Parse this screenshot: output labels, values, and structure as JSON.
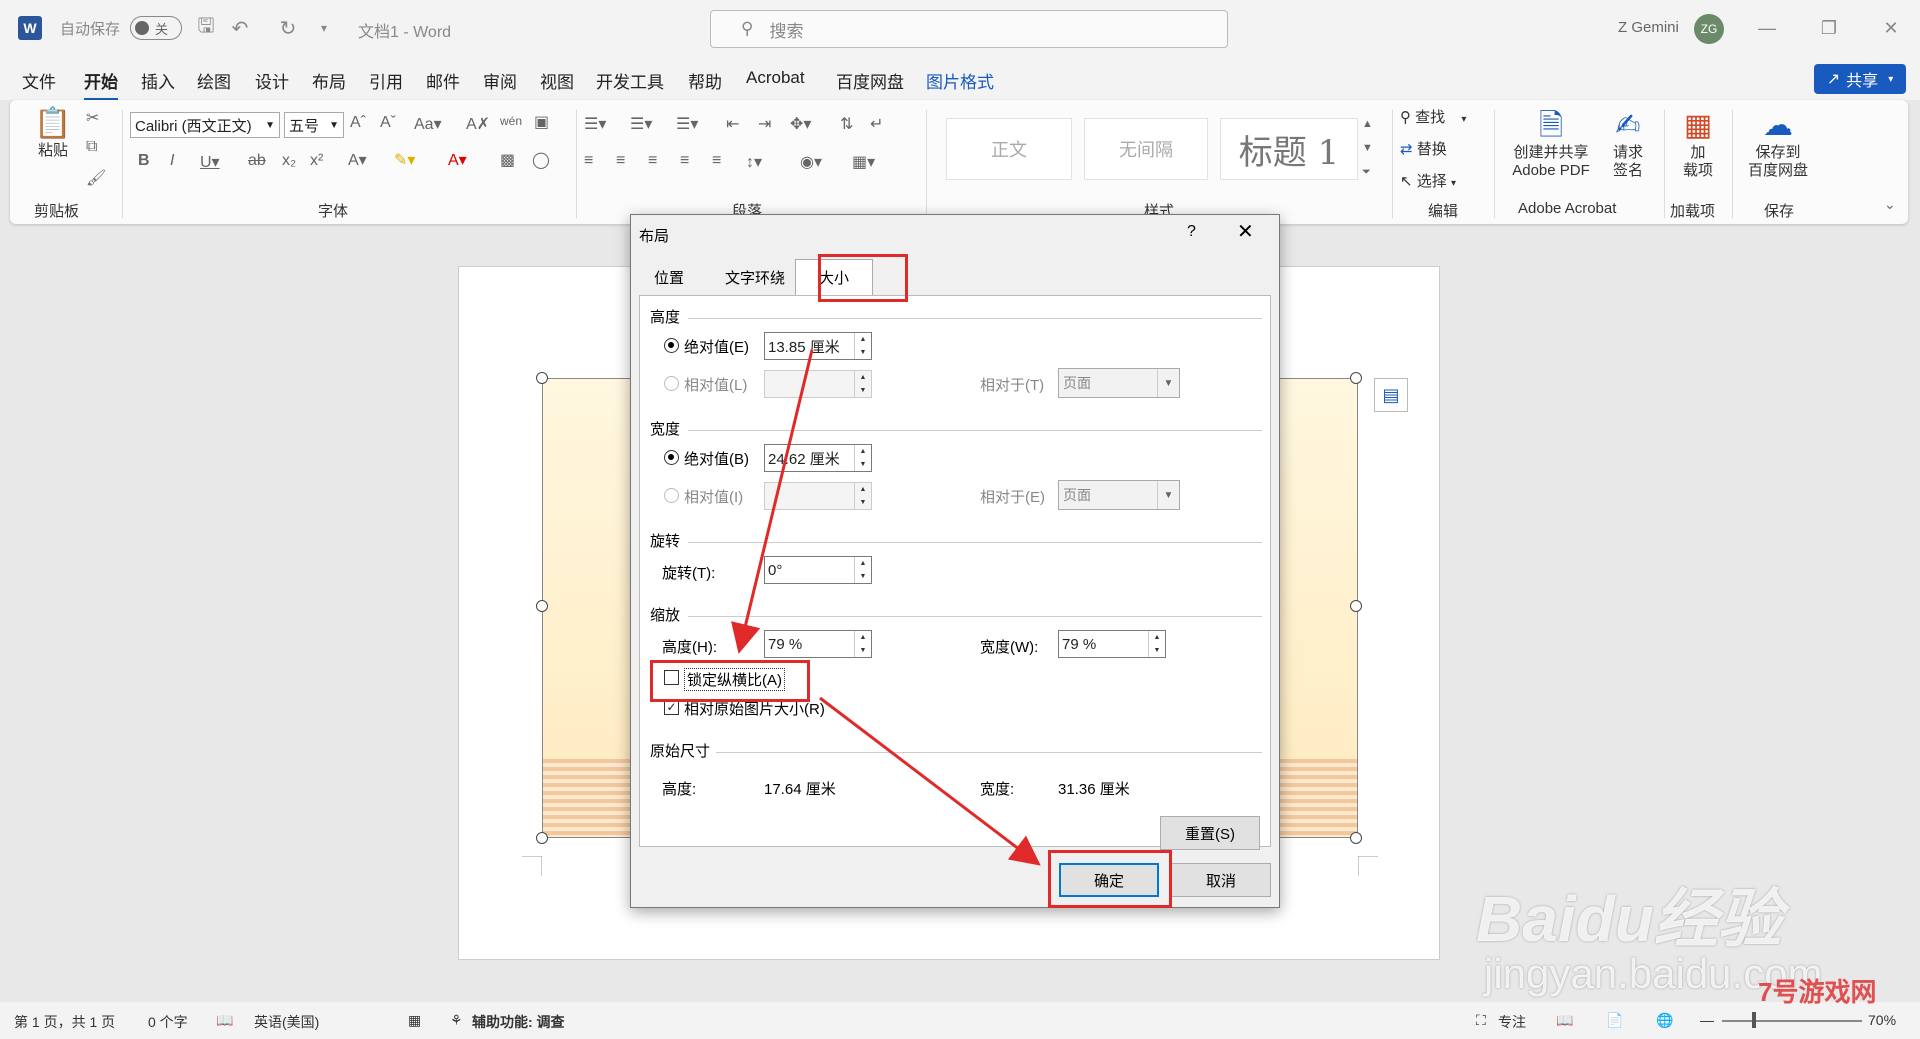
{
  "titlebar": {
    "autosave_label": "自动保存",
    "autosave_state": "关",
    "doc_title": "文档1 - Word",
    "search_placeholder": "搜索",
    "user_name": "Z Gemini",
    "avatar_initials": "ZG"
  },
  "menu": {
    "items": [
      "文件",
      "开始",
      "插入",
      "绘图",
      "设计",
      "布局",
      "引用",
      "邮件",
      "审阅",
      "视图",
      "开发工具",
      "帮助",
      "Acrobat",
      "百度网盘",
      "图片格式"
    ],
    "active": "开始",
    "share_label": "共享"
  },
  "ribbon": {
    "clipboard": {
      "paste": "粘贴",
      "group": "剪贴板"
    },
    "font": {
      "name": "Calibri (西文正文)",
      "size": "五号",
      "group": "字体"
    },
    "paragraph": {
      "group": "段落"
    },
    "styles": {
      "items": [
        "正文",
        "无间隔",
        "标题 1"
      ],
      "group": "样式"
    },
    "editing": {
      "find": "查找",
      "replace": "替换",
      "select": "选择",
      "group": "编辑"
    },
    "acrobat": {
      "create_share": "创建并共享\nAdobe PDF",
      "create_share_line1": "创建并共享",
      "create_share_line2": "Adobe PDF",
      "request_sign_line1": "请求",
      "request_sign_line2": "签名",
      "group": "Adobe Acrobat"
    },
    "addins": {
      "label_line1": "加",
      "label_line2": "载项",
      "group": "加载项"
    },
    "save": {
      "label_line1": "保存到",
      "label_line2": "百度网盘",
      "group": "保存"
    }
  },
  "dialog": {
    "title": "布局",
    "help": "?",
    "tabs": [
      "位置",
      "文字环绕",
      "大小"
    ],
    "active_tab": "大小",
    "height": {
      "section": "高度",
      "absolute_label": "绝对值(E)",
      "absolute_value": "13.85 厘米",
      "relative_label": "相对值(L)",
      "relative_to_label": "相对于(T)",
      "relative_to_value": "页面"
    },
    "width": {
      "section": "宽度",
      "absolute_label": "绝对值(B)",
      "absolute_value": "24.62 厘米",
      "relative_label": "相对值(I)",
      "relative_to_label": "相对于(E)",
      "relative_to_value": "页面"
    },
    "rotation": {
      "section": "旋转",
      "label": "旋转(T):",
      "value": "0°"
    },
    "scale": {
      "section": "缩放",
      "height_label": "高度(H):",
      "height_value": "79 %",
      "width_label": "宽度(W):",
      "width_value": "79 %",
      "lock_aspect_label": "锁定纵横比(A)",
      "lock_aspect_checked": false,
      "relative_original_label": "相对原始图片大小(R)",
      "relative_original_checked": true
    },
    "original": {
      "section": "原始尺寸",
      "height_label": "高度:",
      "height_value": "17.64 厘米",
      "width_label": "宽度:",
      "width_value": "31.36 厘米"
    },
    "reset_label": "重置(S)",
    "ok_label": "确定",
    "cancel_label": "取消"
  },
  "statusbar": {
    "page": "第 1 页，共 1 页",
    "words": "0 个字",
    "language": "英语(美国)",
    "accessibility": "辅助功能: 调查",
    "focus": "专注",
    "zoom": "70%"
  },
  "watermark": {
    "baidu": "Baidu经验",
    "url": "jingyan.baidu.com",
    "site": "7号游戏网"
  },
  "colors": {
    "accent": "#185abd",
    "highlight_red": "#e02a2a"
  }
}
